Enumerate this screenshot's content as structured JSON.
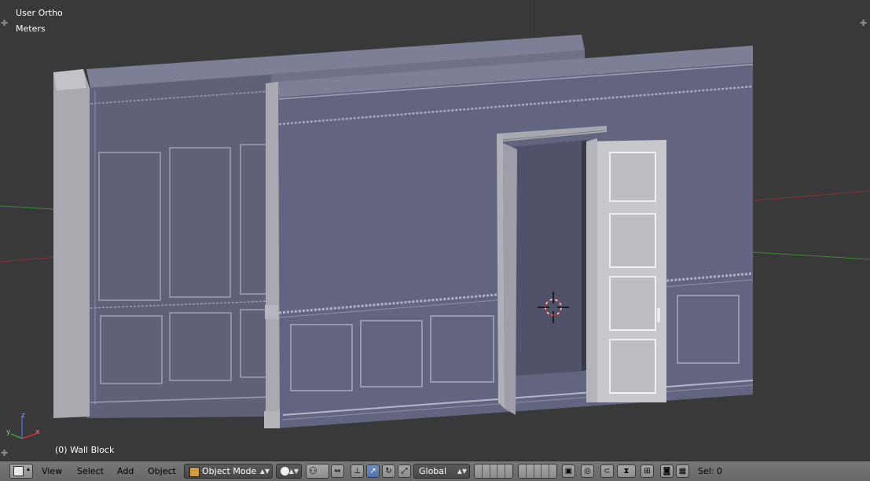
{
  "viewport": {
    "view_name": "User Ortho",
    "units": "Meters",
    "selected_object": "(0) Wall Block",
    "axis_labels": {
      "x": "x",
      "y": "y",
      "z": "z"
    }
  },
  "header": {
    "editor_type_icon": "3d-view-icon",
    "menus": [
      "View",
      "Select",
      "Add",
      "Object"
    ],
    "mode": "Object Mode",
    "shading_icon": "solid-sphere-icon",
    "pivot_icon": "pivot-icon",
    "transform_orientation": "Global",
    "status": "Sel: 0"
  },
  "colors": {
    "viewport_bg": "#393939",
    "wall": "#63657e",
    "x_axis": "#a53636",
    "y_axis": "#4d9a3c",
    "header_bg": "#727272"
  }
}
